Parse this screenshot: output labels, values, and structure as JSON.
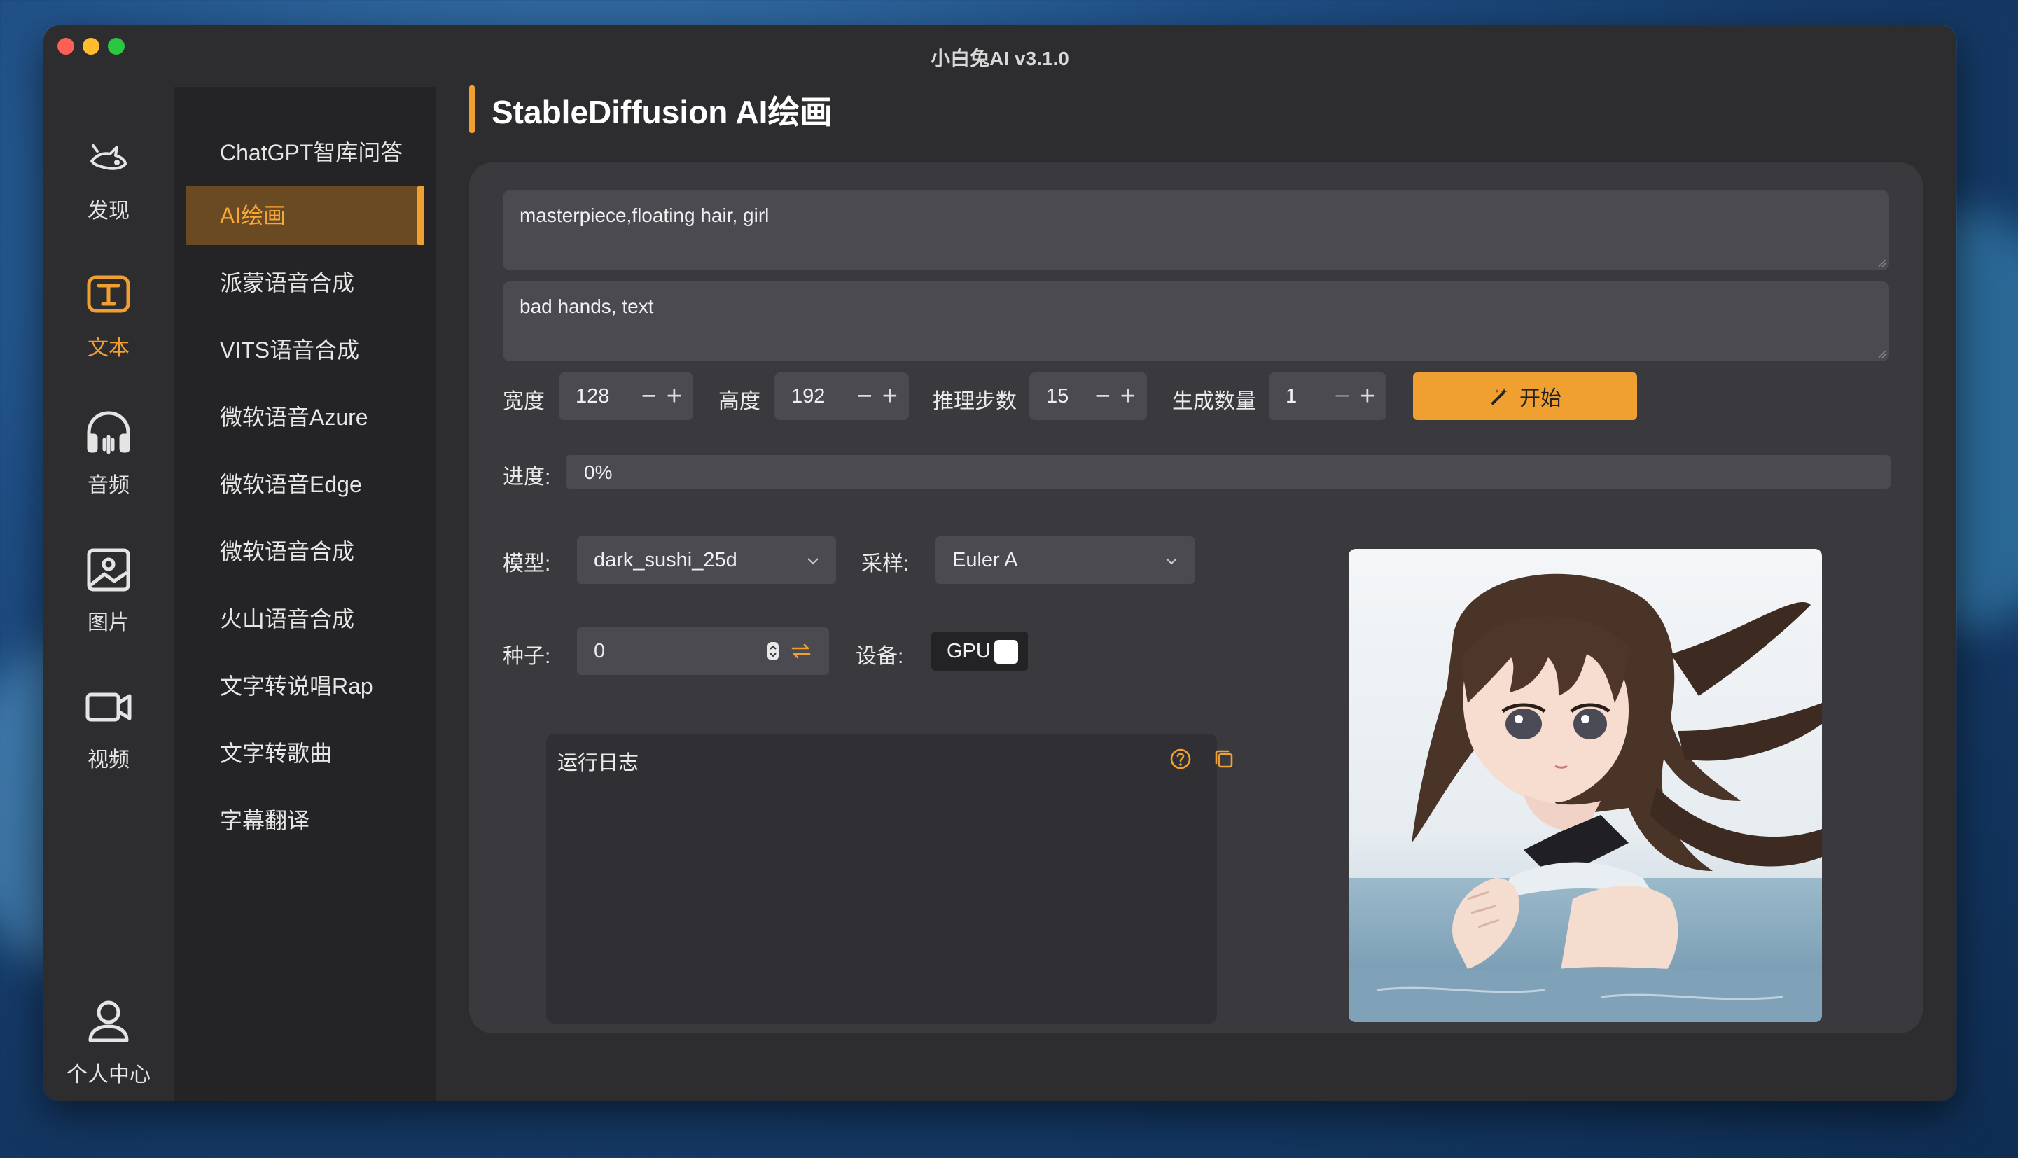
{
  "window": {
    "title": "小白兔AI v3.1.0"
  },
  "iconbar": [
    {
      "label": "发现",
      "icon": "discover-icon"
    },
    {
      "label": "文本",
      "icon": "text-icon"
    },
    {
      "label": "音频",
      "icon": "headphones-icon"
    },
    {
      "label": "图片",
      "icon": "image-icon"
    },
    {
      "label": "视频",
      "icon": "video-icon"
    },
    {
      "label": "个人中心",
      "icon": "user-icon"
    }
  ],
  "menu": [
    {
      "label": "ChatGPT智库问答"
    },
    {
      "label": "AI绘画"
    },
    {
      "label": "派蒙语音合成"
    },
    {
      "label": "VITS语音合成"
    },
    {
      "label": "微软语音Azure"
    },
    {
      "label": "微软语音Edge"
    },
    {
      "label": "微软语音合成"
    },
    {
      "label": "火山语音合成"
    },
    {
      "label": "文字转说唱Rap"
    },
    {
      "label": "文字转歌曲"
    },
    {
      "label": "字幕翻译"
    }
  ],
  "page": {
    "title": "StableDiffusion AI绘画"
  },
  "prompt": {
    "positive": "masterpiece,floating hair, girl",
    "negative": "bad hands, text"
  },
  "params": {
    "width_label": "宽度",
    "width_value": "128",
    "height_label": "高度",
    "height_value": "192",
    "steps_label": "推理步数",
    "steps_value": "15",
    "count_label": "生成数量",
    "count_value": "1",
    "start_label": "开始"
  },
  "progress": {
    "label": "进度:",
    "text": "0%",
    "value": 0
  },
  "model": {
    "label": "模型:",
    "value": "dark_sushi_25d"
  },
  "sampler": {
    "label": "采样:",
    "value": "Euler A"
  },
  "seed": {
    "label": "种子:",
    "value": "0"
  },
  "device": {
    "label": "设备:",
    "value": "GPU"
  },
  "log": {
    "title": "运行日志"
  },
  "colors": {
    "accent": "#f0a030",
    "panel": "#3a3a3e",
    "input": "#4a4a50"
  }
}
